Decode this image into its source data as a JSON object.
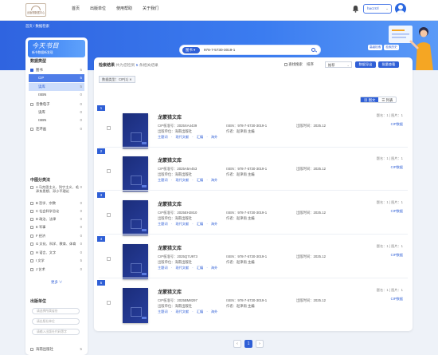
{
  "header": {
    "logo_text": "出版物数据中心",
    "nav": [
      "首页",
      "出版单位",
      "使用帮助",
      "关于我们"
    ],
    "username": "haczrzl"
  },
  "breadcrumb": "首页 / 数据检索",
  "search": {
    "type": "图书",
    "value": "978-7-5730-3019-1",
    "tags": [
      "高级检索",
      "检索历史"
    ]
  },
  "sidebar": {
    "banner_title": "今天书目",
    "banner_sub": "新书数据新发现",
    "data_type_title": "数据类型",
    "data_types": [
      {
        "label": "图书",
        "count": "5",
        "checked": true,
        "level": 0
      },
      {
        "label": "CIP",
        "count": "5",
        "checked": false,
        "level": 1,
        "state": "active"
      },
      {
        "label": "读库",
        "count": "5",
        "checked": false,
        "level": 1,
        "state": "active2"
      },
      {
        "label": "ISBN",
        "count": "0",
        "checked": false,
        "level": 1
      },
      {
        "label": "音像电子",
        "count": "0",
        "checked": false,
        "level": 0
      },
      {
        "label": "读库",
        "count": "0",
        "checked": false,
        "level": 1
      },
      {
        "label": "ISBN",
        "count": "0",
        "checked": false,
        "level": 1
      },
      {
        "label": "连环画",
        "count": "0",
        "checked": false,
        "level": 0
      }
    ],
    "class_title": "中图分类法",
    "classes": [
      {
        "label": "A 马克思主义、列宁主义、毛泽东思想、邓小平理论",
        "count": "0"
      },
      {
        "label": "B 哲学、宗教",
        "count": "0"
      },
      {
        "label": "C 社会科学总论",
        "count": "0"
      },
      {
        "label": "D 政治、法律",
        "count": "0"
      },
      {
        "label": "E 军事",
        "count": "0"
      },
      {
        "label": "F 经济",
        "count": "0"
      },
      {
        "label": "G 文化、科学、教育、体育",
        "count": "0"
      },
      {
        "label": "H 语言、文字",
        "count": "0"
      },
      {
        "label": "I 文学",
        "count": "5"
      },
      {
        "label": "J 艺术",
        "count": "0"
      }
    ],
    "more": "更多 ∨",
    "pub_title": "出版单位",
    "pub_placeholders": [
      "请选择所属省份",
      "请出版社单位",
      "请输入出版社代码等字"
    ],
    "pub_item": {
      "label": "海南出版社",
      "count": "5"
    }
  },
  "results": {
    "title": "检索结果",
    "summary_prefix": "共为您检到",
    "count": "5",
    "summary_suffix": "条相关结果",
    "filter_cb": "查找搜索",
    "sort_label": "排序",
    "sort_value": "推荐",
    "export_btn": "数据导出",
    "batch_btn": "批量查看",
    "filter_tag": "数据类型：CIP(1) ✕",
    "view_cover": "▦ 图文",
    "view_list": "☰ 列表",
    "items": [
      {
        "num": "1",
        "title": "龙蒙猎文库",
        "cip": "2025XA4439",
        "isbn": "978-7-5730-3019-1",
        "date": "2025.12",
        "publisher": "海南出版社",
        "author": "赵津雨 主编",
        "links": "主题词　·　现代文献　·　汇编　·　海外",
        "right1": "题名：1 | 图片：1",
        "right2": "CIP数据"
      },
      {
        "num": "2",
        "title": "龙蒙猎文库",
        "cip": "2025A5A453",
        "isbn": "978-7-5730-3019-1",
        "date": "2025.12",
        "publisher": "海南出版社",
        "author": "赵津雨 主编",
        "links": "主题词　·　现代文献　·　汇编　·　海外",
        "right1": "题名：1 | 图片：1",
        "right2": "CIP数据"
      },
      {
        "num": "3",
        "title": "龙蒙猎文库",
        "cip": "2025EH2810",
        "isbn": "978-7-5730-3019-1",
        "date": "2025.12",
        "publisher": "海南出版社",
        "author": "赵津雨 主编",
        "links": "主题词　·　现代文献　·　汇编　·　海外",
        "right1": "题名：1 | 图片：1",
        "right2": "CIP数据"
      },
      {
        "num": "4",
        "title": "龙蒙猎文库",
        "cip": "2025Q7U973",
        "isbn": "978-7-5730-3019-1",
        "date": "2025.12",
        "publisher": "海南出版社",
        "author": "赵津雨 主编",
        "links": "主题词　·　现代文献　·　汇编　·　海外",
        "right1": "题名：1 | 图片：1",
        "right2": "CIP数据"
      },
      {
        "num": "5",
        "title": "龙蒙猎文库",
        "cip": "2025BM8297",
        "isbn": "978-7-5730-3019-1",
        "date": "2025.12",
        "publisher": "海南出版社",
        "author": "赵津雨 主编",
        "links": "主题词　·　现代文献　·　汇编　·　海外",
        "right1": "题名：1 | 图片：1",
        "right2": "CIP数据"
      }
    ],
    "labels": {
      "cip": "CIP核准号：",
      "isbn": "ISBN：",
      "date": "出版时间：",
      "publisher": "出版单位：",
      "author": "作者："
    }
  },
  "pager": {
    "prev": "‹",
    "current": "1",
    "next": "›"
  },
  "colors": {
    "primary": "#2f5fd6",
    "banner": "#3b7cf0",
    "background": "#eef2f8"
  }
}
